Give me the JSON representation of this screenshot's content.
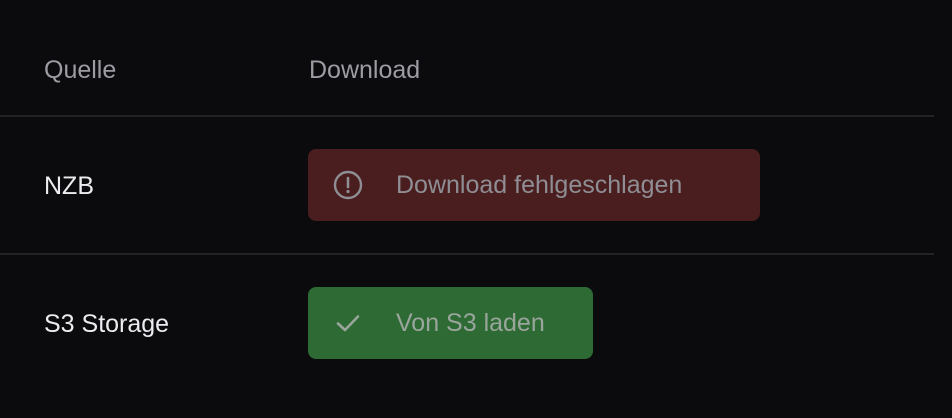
{
  "table": {
    "headers": {
      "source": "Quelle",
      "download": "Download"
    },
    "rows": [
      {
        "source": "NZB",
        "action": {
          "label": "Download fehlgeschlagen",
          "status": "error",
          "icon": "alert-circle-icon",
          "color": "#4a1e1e"
        }
      },
      {
        "source": "S3 Storage",
        "action": {
          "label": "Von S3 laden",
          "status": "success",
          "icon": "check-icon",
          "color": "#2d6a34"
        }
      }
    ]
  },
  "colors": {
    "background": "#0b0b0d",
    "divider": "#232326",
    "header_text": "#9c9ca3",
    "cell_text": "#ececf0"
  }
}
